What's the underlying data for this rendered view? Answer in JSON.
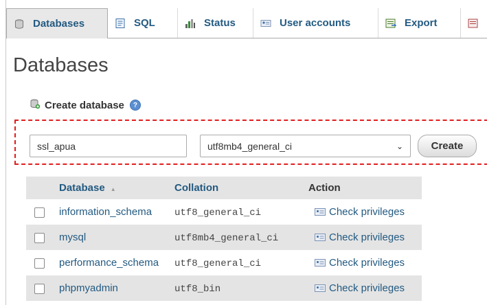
{
  "tabs": [
    {
      "label": "Databases",
      "icon": "database-icon",
      "active": true
    },
    {
      "label": "SQL",
      "icon": "sql-icon"
    },
    {
      "label": "Status",
      "icon": "status-icon"
    },
    {
      "label": "User accounts",
      "icon": "user-accounts-icon"
    },
    {
      "label": "Export",
      "icon": "export-icon"
    },
    {
      "label": "",
      "icon": "import-icon"
    }
  ],
  "page": {
    "title": "Databases"
  },
  "create": {
    "heading": "Create database",
    "db_name_value": "ssl_apua",
    "collation_value": "utf8mb4_general_ci",
    "button_label": "Create"
  },
  "table": {
    "headers": {
      "database": "Database",
      "collation": "Collation",
      "action": "Action"
    },
    "rows": [
      {
        "name": "information_schema",
        "collation": "utf8_general_ci",
        "action": "Check privileges"
      },
      {
        "name": "mysql",
        "collation": "utf8mb4_general_ci",
        "action": "Check privileges"
      },
      {
        "name": "performance_schema",
        "collation": "utf8_general_ci",
        "action": "Check privileges"
      },
      {
        "name": "phpmyadmin",
        "collation": "utf8_bin",
        "action": "Check privileges"
      }
    ]
  },
  "colors": {
    "link": "#235a81",
    "highlight_border": "#e21c1c",
    "row_alt": "#e4e4e4"
  }
}
